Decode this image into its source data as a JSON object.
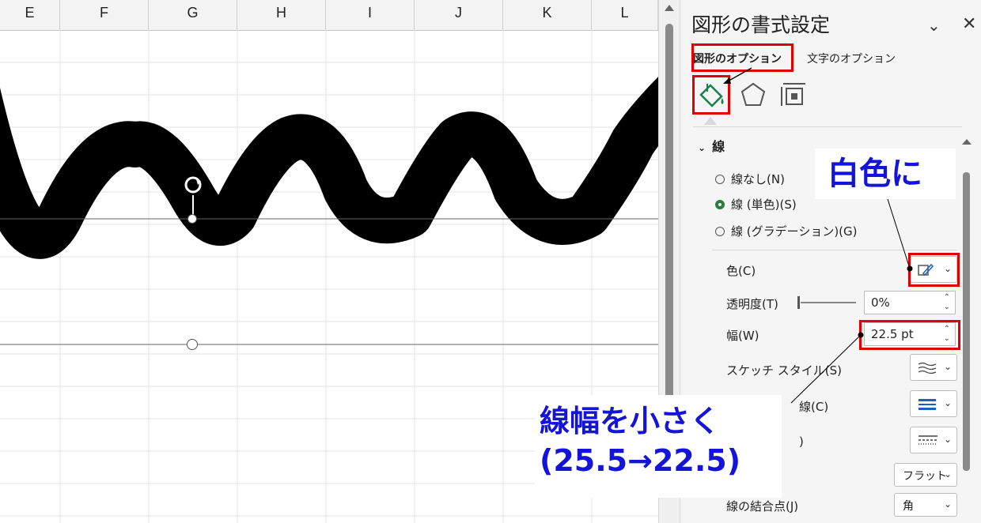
{
  "sheet": {
    "columns": [
      "E",
      "F",
      "G",
      "H",
      "I",
      "J",
      "K",
      "L"
    ]
  },
  "pane": {
    "title": "図形の書式設定",
    "tabs": [
      {
        "label": "図形のオプション",
        "selected": true
      },
      {
        "label": "文字のオプション",
        "selected": false
      }
    ],
    "icons": [
      "fill-line-icon",
      "pentagon-effects-icon",
      "size-properties-icon"
    ],
    "section_label": "線",
    "line_options": [
      {
        "label": "線なし(N)",
        "selected": false
      },
      {
        "label": "線 (単色)(S)",
        "selected": true
      },
      {
        "label": "線 (グラデーション)(G)",
        "selected": false
      }
    ],
    "color_label": "色(C)",
    "transparency_label": "透明度(T)",
    "transparency_value": "0%",
    "transparency_level": 0,
    "width_label": "幅(W)",
    "width_value": "22.5 pt",
    "sketch_label": "スケッチ スタイル(S)",
    "compound_label_partial": "線(C)",
    "dash_label_partial": ")",
    "cap_value": "フラット",
    "join_label": "線の結合点(J)",
    "join_value": "角"
  },
  "annotations": {
    "color_callout": "白色に",
    "width_callout_line1": "線幅を小さく",
    "width_callout_line2": "(25.5→22.5)",
    "highlight_color": "#e00000",
    "callout_text_color": "#1414d8"
  },
  "colors": {
    "radio_selected": "#2a7d3c",
    "wave_stroke": "#000000"
  }
}
